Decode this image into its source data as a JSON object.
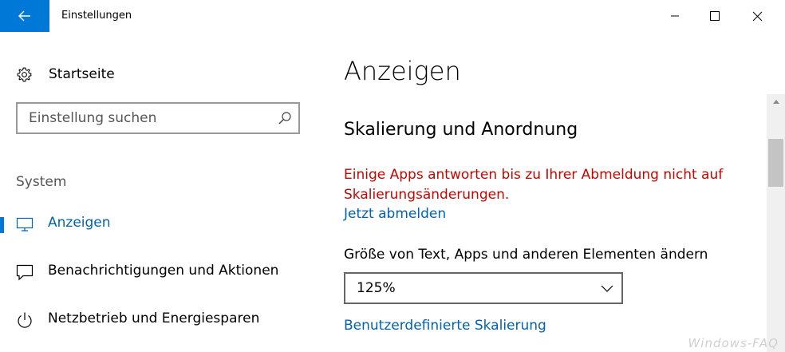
{
  "window": {
    "title": "Einstellungen",
    "back_icon": "arrow-left-icon",
    "controls": [
      "minimize-icon",
      "maximize-icon",
      "close-icon"
    ],
    "accent_color": "#0078d7"
  },
  "sidebar": {
    "home_label": "Startseite",
    "search_placeholder": "Einstellung suchen",
    "section_header": "System",
    "items": [
      {
        "label": "Anzeigen",
        "icon": "monitor-icon",
        "active": true
      },
      {
        "label": "Benachrichtigungen und Aktionen",
        "icon": "notification-icon",
        "active": false
      },
      {
        "label": "Netzbetrieb und Energiesparen",
        "icon": "power-icon",
        "active": false
      }
    ]
  },
  "main": {
    "page_title": "Anzeigen",
    "section_title": "Skalierung und Anordnung",
    "warning_text": "Einige Apps antworten bis zu Ihrer Abmeldung nicht auf Skalierungsänderungen.",
    "warning_color": "#c50500",
    "signout_link": "Jetzt abmelden",
    "scale_label": "Größe von Text, Apps und anderen Elementen ändern",
    "scale_value": "125%",
    "custom_scaling_link": "Benutzerdefinierte Skalierung",
    "link_color": "#0063b1"
  },
  "watermark": "Windows-FAQ"
}
